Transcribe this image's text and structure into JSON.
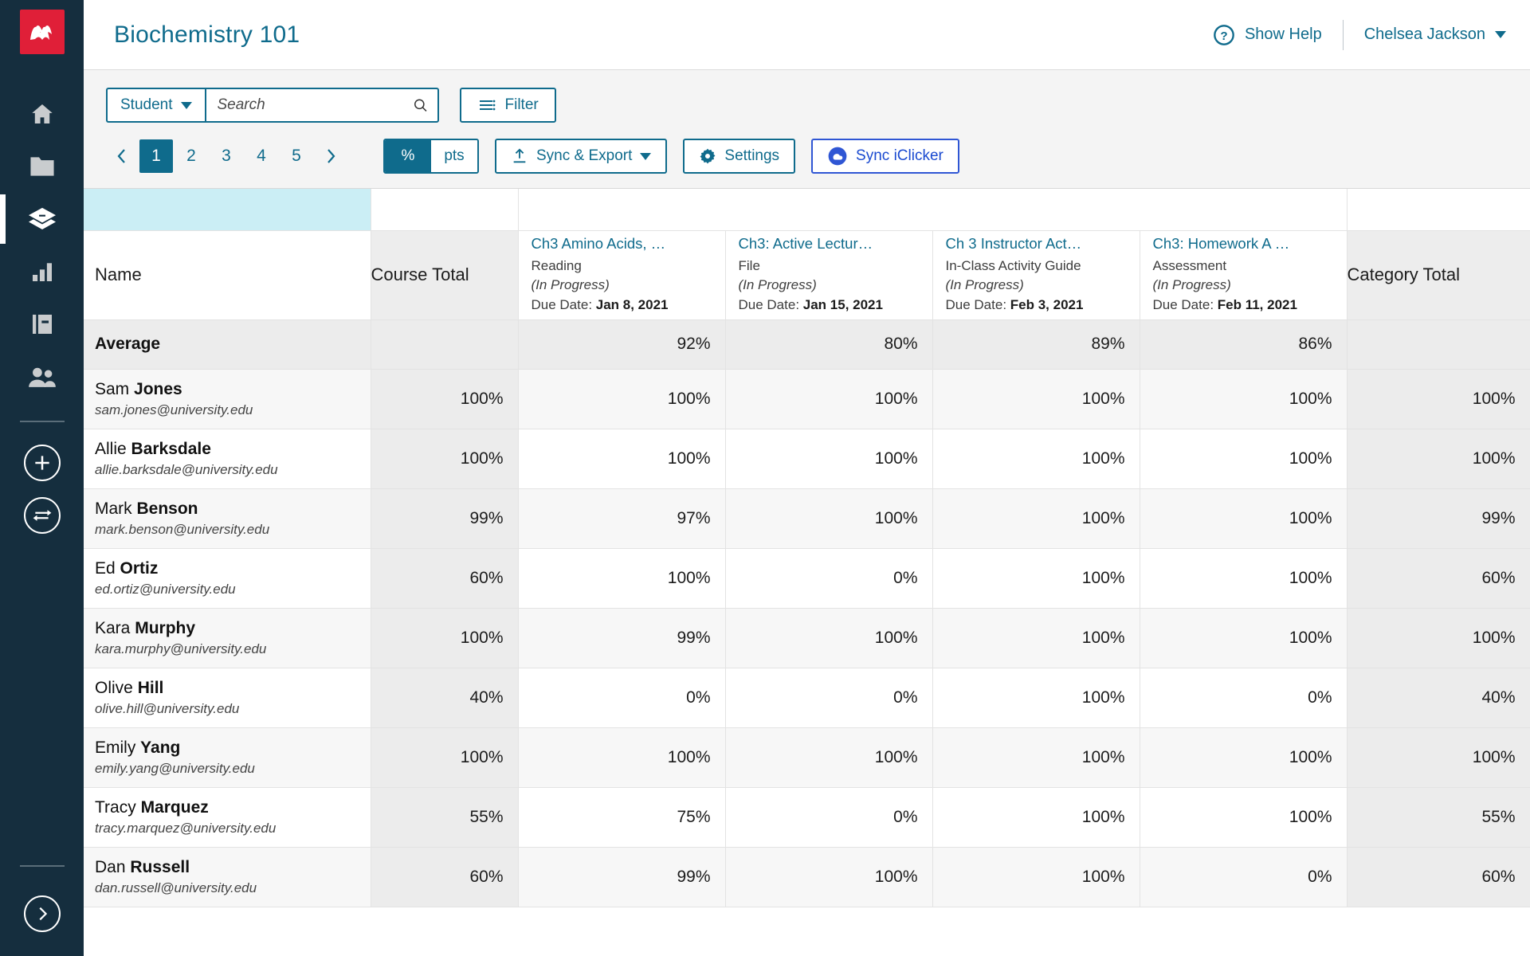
{
  "sidebar": {
    "logo_name": "macmillan-logo",
    "items": [
      {
        "name": "home-icon",
        "label": "Home",
        "active": false
      },
      {
        "name": "folder-icon",
        "label": "Resources",
        "active": false
      },
      {
        "name": "layers-icon",
        "label": "Course",
        "active": true
      },
      {
        "name": "bar-chart-icon",
        "label": "Reports",
        "active": false
      },
      {
        "name": "book-icon",
        "label": "Gradebook",
        "active": false
      },
      {
        "name": "people-icon",
        "label": "Roster",
        "active": false
      }
    ],
    "actions": [
      {
        "name": "add-circle-icon",
        "label": "Add"
      },
      {
        "name": "swap-circle-icon",
        "label": "Swap"
      }
    ],
    "expand": {
      "name": "expand-circle-icon",
      "label": "Expand"
    }
  },
  "header": {
    "course_title": "Biochemistry 101",
    "help_label": "Show Help",
    "help_icon": "question-circle-icon",
    "user_name": "Chelsea Jackson",
    "user_caret": "caret-down-icon"
  },
  "toolbar": {
    "scope_label": "Student",
    "scope_caret": "caret-down-icon",
    "search_placeholder": "Search",
    "search_value": "",
    "search_icon": "search-icon",
    "filter_label": "Filter",
    "filter_icon": "filter-lines-icon",
    "pager": {
      "prev_icon": "chevron-left-icon",
      "next_icon": "chevron-right-icon",
      "pages": [
        "1",
        "2",
        "3",
        "4",
        "5"
      ],
      "active_page": "1"
    },
    "unit_toggle": {
      "percent": "%",
      "points": "pts",
      "selected": "%"
    },
    "sync_export_label": "Sync & Export",
    "sync_export_icon": "upload-icon",
    "sync_export_caret": "caret-down-icon",
    "settings_label": "Settings",
    "settings_icon": "gear-icon",
    "sync_iclicker_label": "Sync iClicker",
    "sync_iclicker_icon": "iclicker-cloud-icon"
  },
  "colors": {
    "accent": "#0f6b8c",
    "sidebar_bg": "#152e3e",
    "logo_red": "#e01f38",
    "iclicker_blue": "#2f56d4",
    "band_cyan": "#cbeef5",
    "total_col_bg": "#ececec"
  },
  "table": {
    "name_header": "Name",
    "course_total_header": "Course Total",
    "category_total_header": "Category Total",
    "assignments": [
      {
        "title": "Ch3 Amino Acids, …",
        "type": "Reading",
        "status": "(In Progress)",
        "due_prefix": "Due Date: ",
        "due_date": "Jan 8, 2021"
      },
      {
        "title": "Ch3: Active Lectur…",
        "type": "File",
        "status": "(In Progress)",
        "due_prefix": "Due Date: ",
        "due_date": "Jan 15, 2021"
      },
      {
        "title": "Ch 3 Instructor Act…",
        "type": "In-Class Activity Guide",
        "status": "(In Progress)",
        "due_prefix": "Due Date: ",
        "due_date": "Feb 3, 2021"
      },
      {
        "title": "Ch3: Homework A …",
        "type": "Assessment",
        "status": "(In Progress)",
        "due_prefix": "Due Date: ",
        "due_date": "Feb 11, 2021"
      }
    ],
    "average_row": {
      "label": "Average",
      "course_total": "",
      "scores": [
        "92%",
        "80%",
        "89%",
        "86%"
      ],
      "category_total": ""
    },
    "rows": [
      {
        "first": "Sam ",
        "last": "Jones",
        "email": "sam.jones@university.edu",
        "course_total": "100%",
        "scores": [
          "100%",
          "100%",
          "100%",
          "100%"
        ],
        "category_total": "100%"
      },
      {
        "first": "Allie ",
        "last": "Barksdale",
        "email": "allie.barksdale@university.edu",
        "course_total": "100%",
        "scores": [
          "100%",
          "100%",
          "100%",
          "100%"
        ],
        "category_total": "100%"
      },
      {
        "first": "Mark ",
        "last": "Benson",
        "email": "mark.benson@university.edu",
        "course_total": "99%",
        "scores": [
          "97%",
          "100%",
          "100%",
          "100%"
        ],
        "category_total": "99%"
      },
      {
        "first": "Ed ",
        "last": "Ortiz",
        "email": "ed.ortiz@university.edu",
        "course_total": "60%",
        "scores": [
          "100%",
          "0%",
          "100%",
          "100%"
        ],
        "category_total": "60%"
      },
      {
        "first": "Kara ",
        "last": "Murphy",
        "email": "kara.murphy@university.edu",
        "course_total": "100%",
        "scores": [
          "99%",
          "100%",
          "100%",
          "100%"
        ],
        "category_total": "100%"
      },
      {
        "first": "Olive ",
        "last": "Hill",
        "email": "olive.hill@university.edu",
        "course_total": "40%",
        "scores": [
          "0%",
          "0%",
          "100%",
          "0%"
        ],
        "category_total": "40%"
      },
      {
        "first": "Emily ",
        "last": "Yang",
        "email": "emily.yang@university.edu",
        "course_total": "100%",
        "scores": [
          "100%",
          "100%",
          "100%",
          "100%"
        ],
        "category_total": "100%"
      },
      {
        "first": "Tracy ",
        "last": "Marquez",
        "email": "tracy.marquez@university.edu",
        "course_total": "55%",
        "scores": [
          "75%",
          "0%",
          "100%",
          "100%"
        ],
        "category_total": "55%"
      },
      {
        "first": "Dan ",
        "last": "Russell",
        "email": "dan.russell@university.edu",
        "course_total": "60%",
        "scores": [
          "99%",
          "100%",
          "100%",
          "0%"
        ],
        "category_total": "60%"
      }
    ]
  }
}
